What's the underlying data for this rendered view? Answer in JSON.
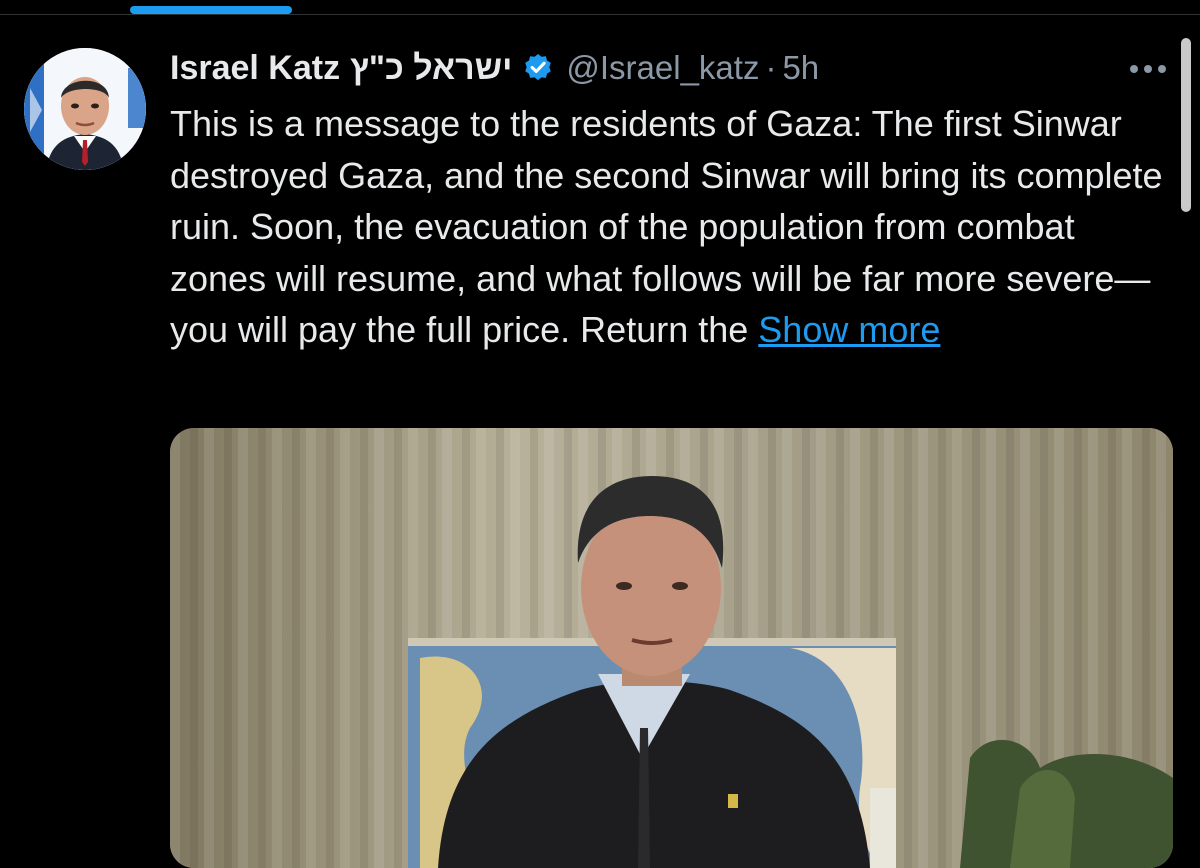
{
  "tweet": {
    "display_name": "Israel Katz",
    "hebrew_name": "ישראל כ\"ץ",
    "handle": "@Israel_katz",
    "separator": "·",
    "time": "5h",
    "text": "This is a message to the residents of Gaza: The first Sinwar destroyed Gaza, and the second Sinwar will bring its complete ruin. Soon, the evacuation of the population from combat zones will resume, and what follows will be far more severe—you will pay the full price. Return the ",
    "show_more_label": "Show more",
    "verified_icon": "verified-badge-icon",
    "more_icon": "more-horizontal-icon"
  },
  "colors": {
    "background": "#000000",
    "text": "#e7e9ea",
    "secondary": "#8b98a5",
    "link": "#1d9bf0",
    "verified": "#1d9bf0"
  }
}
